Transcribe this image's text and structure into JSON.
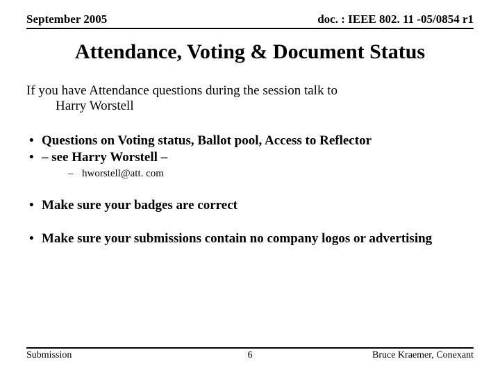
{
  "header": {
    "left": "September 2005",
    "right": "doc. : IEEE 802. 11 -05/0854 r1"
  },
  "title": "Attendance, Voting & Document Status",
  "intro": {
    "line1": "If you have Attendance questions during the session talk to",
    "line2": "Harry Worstell"
  },
  "bullets": {
    "b1": "Questions on Voting status, Ballot pool, Access to Reflector",
    "b2": "– see Harry Worstell –",
    "b2_sub1": "hworstell@att. com",
    "b3": "Make sure your badges are correct",
    "b4": "Make sure your submissions contain no company logos or advertising"
  },
  "footer": {
    "left": "Submission",
    "page": "6",
    "right": "Bruce Kraemer, Conexant"
  }
}
